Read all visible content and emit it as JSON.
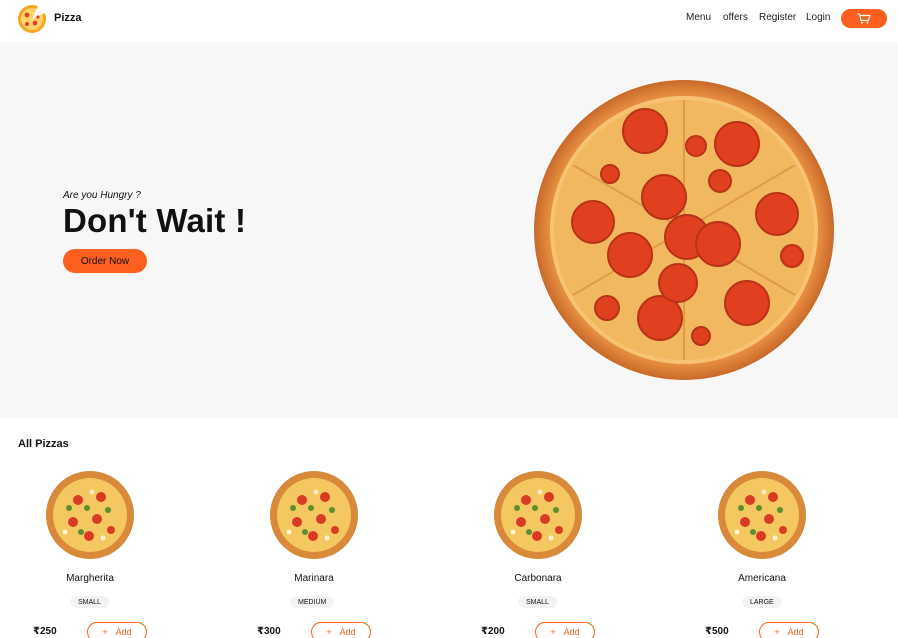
{
  "header": {
    "brand": "Pizza",
    "logo_icon": "pizza-logo-icon",
    "nav": {
      "menu": "Menu",
      "offers": "offers",
      "register": "Register",
      "login": "Login"
    },
    "cart_icon": "cart-icon"
  },
  "hero": {
    "subtitle": "Are you Hungry ?",
    "title": "Don't Wait !",
    "cta": "Order Now",
    "image_icon": "pepperoni-pizza-image"
  },
  "products": {
    "title": "All Pizzas",
    "items": [
      {
        "name": "Margherita",
        "size": "SMALL",
        "price": "₹250",
        "add": "Add"
      },
      {
        "name": "Marinara",
        "size": "MEDIUM",
        "price": "₹300",
        "add": "Add"
      },
      {
        "name": "Carbonara",
        "size": "SMALL",
        "price": "₹200",
        "add": "Add"
      },
      {
        "name": "Americana",
        "size": "LARGE",
        "price": "₹500",
        "add": "Add"
      }
    ]
  },
  "colors": {
    "accent": "#fe5f1e",
    "hero_bg": "#f7f7f7",
    "text": "#111111"
  }
}
